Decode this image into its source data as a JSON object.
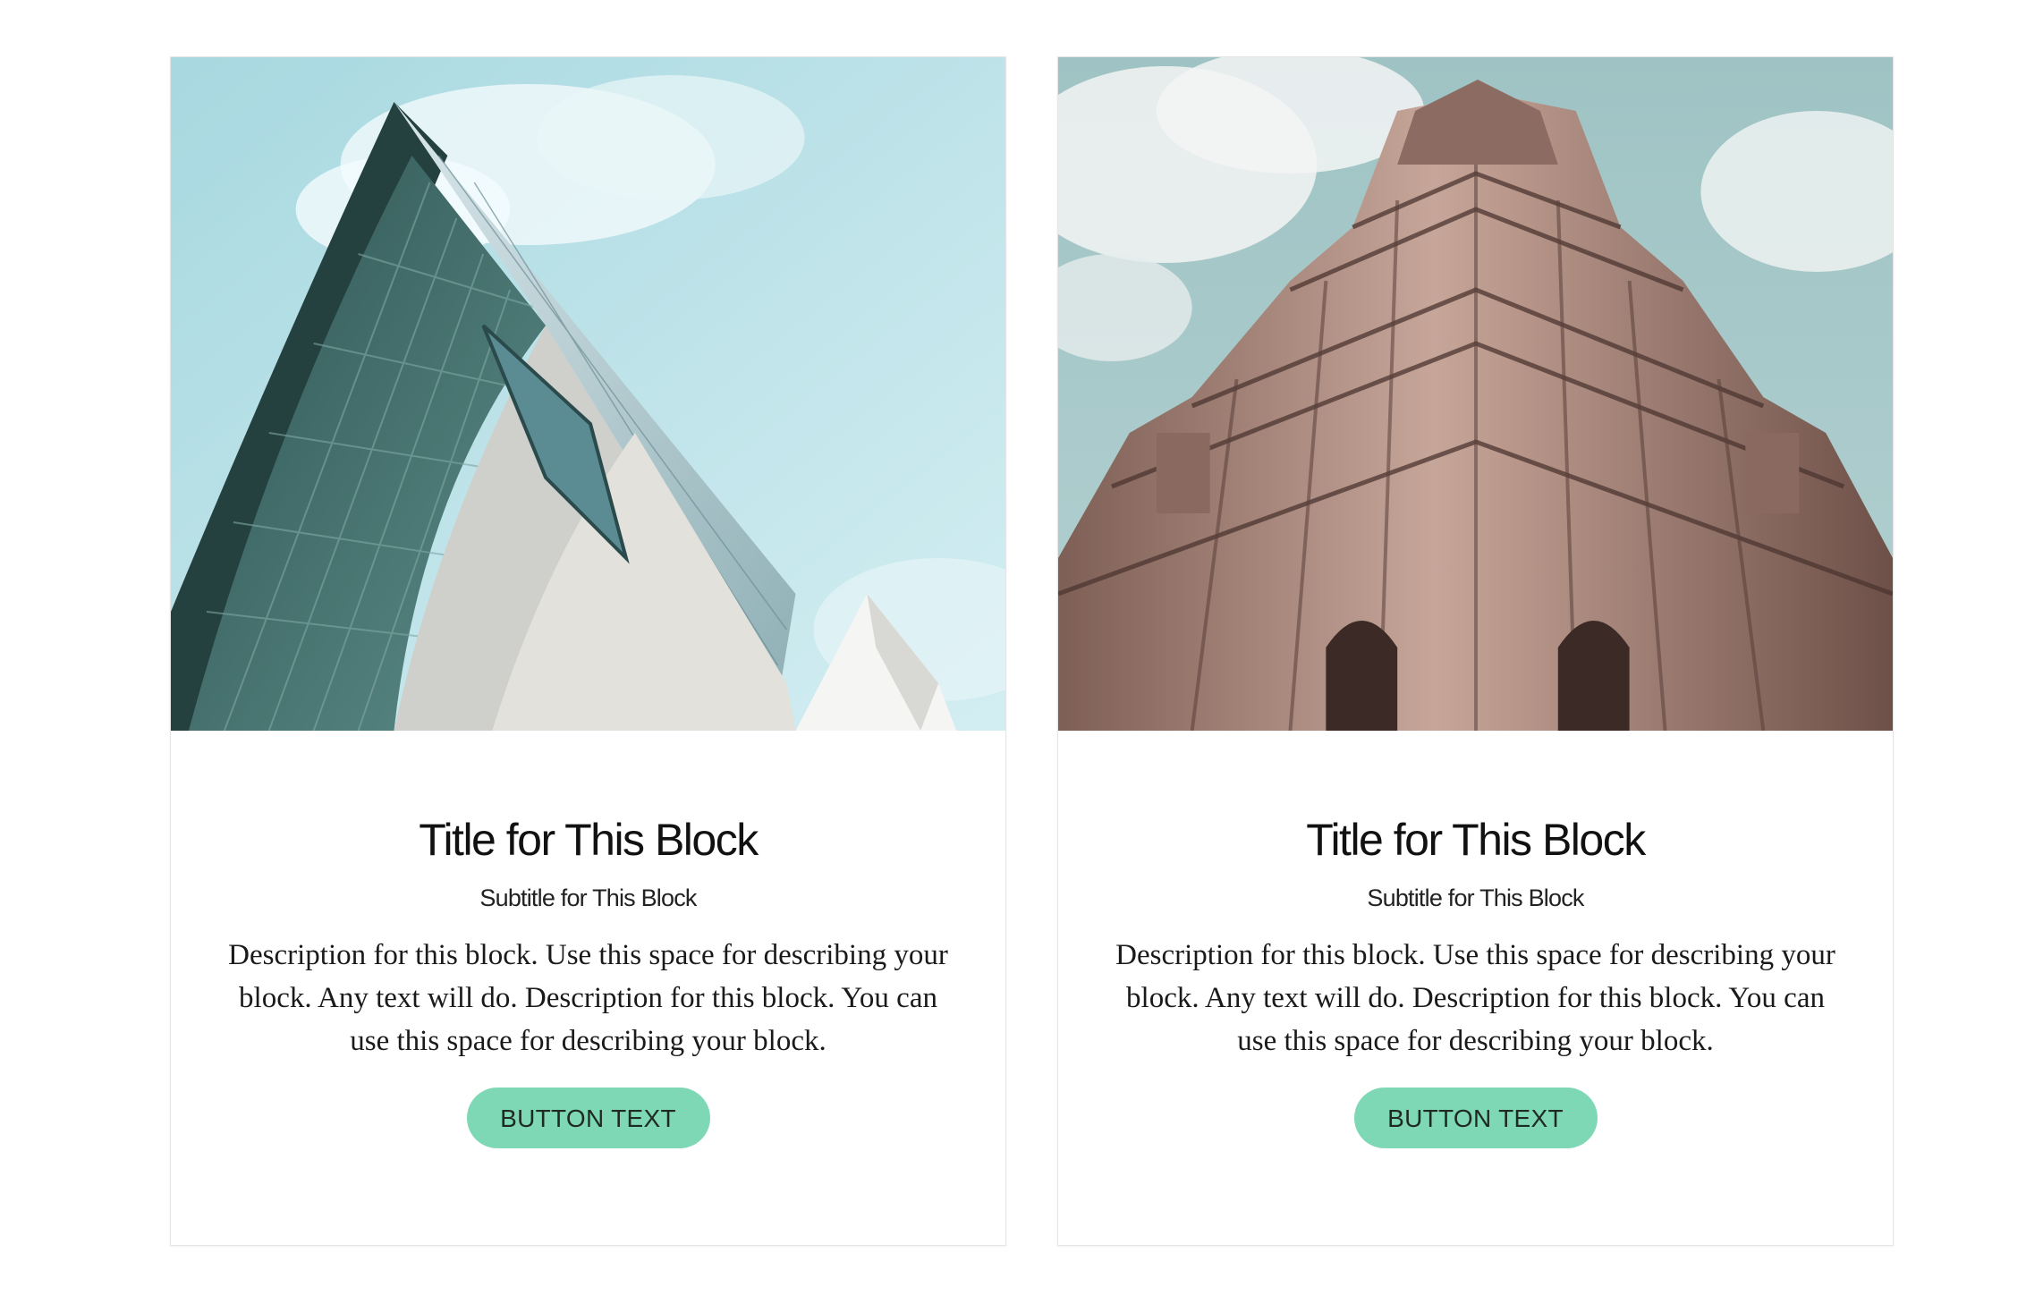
{
  "cards": [
    {
      "image_alt": "modern glass building",
      "title": "Title for This Block",
      "subtitle": "Subtitle for This Block",
      "description": "Description for this block. Use this space for describing your block. Any text will do. Description for this block. You can use this space for describing your block.",
      "button_label": "BUTTON TEXT"
    },
    {
      "image_alt": "ornate stone tower",
      "title": "Title for This Block",
      "subtitle": "Subtitle for This Block",
      "description": "Description for this block. Use this space for describing your block. Any text will do. Description for this block. You can use this space for describing your block.",
      "button_label": "BUTTON TEXT"
    }
  ],
  "colors": {
    "button_bg": "#7ed8b5",
    "button_text": "#1f2a24",
    "sky_left": "#bfe3ea",
    "sky_right": "#a9cccd",
    "glass_panel": "#3f6e6b",
    "stone": "#b8968a"
  }
}
